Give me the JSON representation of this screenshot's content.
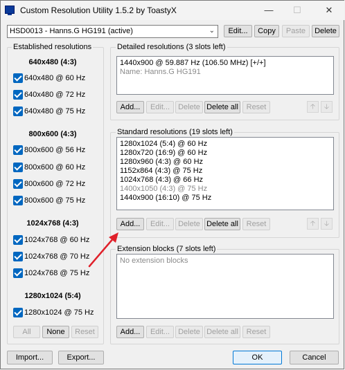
{
  "window": {
    "title": "Custom Resolution Utility 1.5.2 by ToastyX",
    "controls": {
      "minimize": "—",
      "maximize": "☐",
      "close": "✕"
    }
  },
  "monitor": {
    "selected": "HSD0013 - Hanns.G HG191 (active)",
    "edit": "Edit...",
    "copy": "Copy",
    "paste": "Paste",
    "delete": "Delete"
  },
  "established": {
    "label": "Established resolutions",
    "groups": [
      {
        "heading": "640x480 (4:3)",
        "items": [
          "640x480 @ 60 Hz",
          "640x480 @ 72 Hz",
          "640x480 @ 75 Hz"
        ]
      },
      {
        "heading": "800x600 (4:3)",
        "items": [
          "800x600 @ 56 Hz",
          "800x600 @ 60 Hz",
          "800x600 @ 72 Hz",
          "800x600 @ 75 Hz"
        ]
      },
      {
        "heading": "1024x768 (4:3)",
        "items": [
          "1024x768 @ 60 Hz",
          "1024x768 @ 70 Hz",
          "1024x768 @ 75 Hz"
        ]
      },
      {
        "heading": "1280x1024 (5:4)",
        "items": [
          "1280x1024 @ 75 Hz"
        ]
      }
    ],
    "all": "All",
    "none": "None",
    "reset": "Reset"
  },
  "detailed": {
    "label": "Detailed resolutions (3 slots left)",
    "items": [
      "1440x900 @ 59.887 Hz (106.50 MHz) [+/+]"
    ],
    "name_line": "Name: Hanns.G HG191",
    "add": "Add...",
    "edit": "Edit...",
    "delete": "Delete",
    "delete_all": "Delete all",
    "reset": "Reset"
  },
  "standard": {
    "label": "Standard resolutions (19 slots left)",
    "items": [
      {
        "text": "1280x1024 (5:4) @ 60 Hz",
        "grey": false
      },
      {
        "text": "1280x720 (16:9) @ 60 Hz",
        "grey": false
      },
      {
        "text": "1280x960 (4:3) @ 60 Hz",
        "grey": false
      },
      {
        "text": "1152x864 (4:3) @ 75 Hz",
        "grey": false
      },
      {
        "text": "1024x768 (4:3) @ 66 Hz",
        "grey": false
      },
      {
        "text": "1400x1050 (4:3) @ 75 Hz",
        "grey": true
      },
      {
        "text": "1440x900 (16:10) @ 75 Hz",
        "grey": false
      }
    ],
    "add": "Add...",
    "edit": "Edit...",
    "delete": "Delete",
    "delete_all": "Delete all",
    "reset": "Reset"
  },
  "extension": {
    "label": "Extension blocks (7 slots left)",
    "empty": "No extension blocks",
    "add": "Add...",
    "edit": "Edit...",
    "delete": "Delete",
    "delete_all": "Delete all",
    "reset": "Reset"
  },
  "footer": {
    "import": "Import...",
    "export": "Export...",
    "ok": "OK",
    "cancel": "Cancel"
  },
  "colors": {
    "accent": "#0067c0",
    "annotation_arrow": "#e0202a"
  }
}
